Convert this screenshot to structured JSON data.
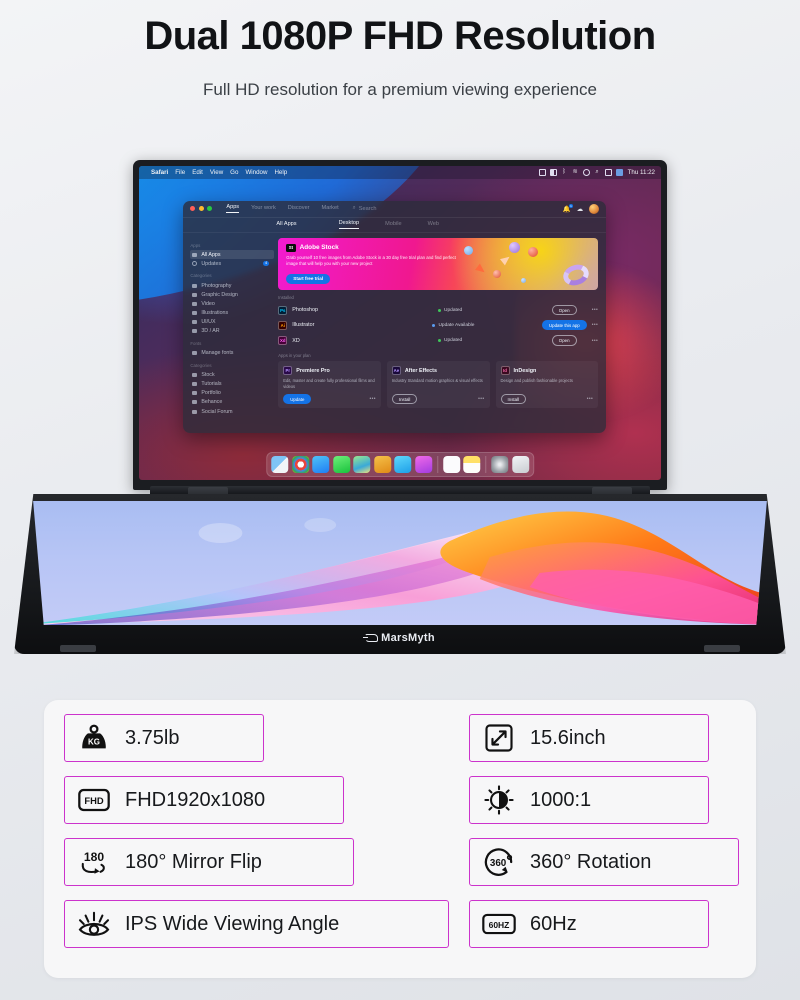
{
  "header": {
    "title": "Dual 1080P FHD Resolution",
    "subtitle": "Full HD resolution for a premium viewing experience"
  },
  "brand": {
    "name": "MarsMyth"
  },
  "accent_colors": {
    "spec_border": "#cc33cc",
    "panel_bg": "#f7f7f8",
    "adobe_blue": "#1473e6"
  },
  "laptop": {
    "top_screen": {
      "menubar": {
        "apple_glyph": "",
        "items": [
          "Safari",
          "File",
          "Edit",
          "View",
          "Go",
          "Window",
          "Help"
        ],
        "status_icons": [
          "screen-share-icon",
          "battery-icon",
          "bluetooth-icon",
          "wifi-icon",
          "control-center-icon",
          "search-icon",
          "display-icon",
          "user-icon"
        ],
        "clock": "Thu 11:22"
      },
      "window": {
        "tabs": [
          {
            "label": "Apps",
            "active": true
          },
          {
            "label": "Your work",
            "active": false
          },
          {
            "label": "Discover",
            "active": false
          },
          {
            "label": "Market",
            "active": false
          }
        ],
        "search_placeholder": "Search",
        "notification_count": "1",
        "subtabs": [
          {
            "label": "All Apps",
            "lead": true
          },
          {
            "label": "Desktop",
            "active": true
          },
          {
            "label": "Mobile",
            "active": false
          },
          {
            "label": "Web",
            "active": false
          }
        ],
        "sidebar": [
          {
            "group": "Apps",
            "items": [
              {
                "label": "All Apps",
                "selected": true,
                "badge": ""
              },
              {
                "label": "Updates",
                "selected": false,
                "badge": "4"
              }
            ]
          },
          {
            "group": "Categories",
            "items": [
              {
                "label": "Photography"
              },
              {
                "label": "Graphic Design"
              },
              {
                "label": "Video"
              },
              {
                "label": "Illustrations"
              },
              {
                "label": "UI/UX"
              },
              {
                "label": "3D / AR"
              }
            ]
          },
          {
            "group": "Fonts",
            "items": [
              {
                "label": "Manage fonts"
              }
            ]
          },
          {
            "group": "Categories",
            "items": [
              {
                "label": "Stock"
              },
              {
                "label": "Tutorials"
              },
              {
                "label": "Portfolio"
              },
              {
                "label": "Behance"
              },
              {
                "label": "Social Forum"
              }
            ]
          }
        ],
        "promo": {
          "chip": "St",
          "title": "Adobe Stock",
          "description": "Grab yourself 10 free images from Adobe Stock in a 30 day free trial plan and find perfect image that will help you with your new project",
          "button": "Start free trial"
        },
        "installed_label": "Installed",
        "installed": [
          {
            "icon": "Ps",
            "icon_color": "#00c8ff",
            "icon_bg": "#001e36",
            "name": "Photoshop",
            "status": "Updated",
            "status_color": "#3ec95a",
            "action": "Open",
            "action_style": "outline"
          },
          {
            "icon": "Ai",
            "icon_color": "#ff9a00",
            "icon_bg": "#330000",
            "name": "Illustrator",
            "status": "Update Available",
            "status_color": "#5a9cf0",
            "action": "Update this app",
            "action_style": "solid"
          },
          {
            "icon": "Xd",
            "icon_color": "#ff61f6",
            "icon_bg": "#470137",
            "name": "XD",
            "status": "Updated",
            "status_color": "#3ec95a",
            "action": "Open",
            "action_style": "outline"
          }
        ],
        "plan_label": "Apps in your plan",
        "plan_apps": [
          {
            "icon": "Pr",
            "icon_color": "#b695ff",
            "icon_bg": "#2a0a4a",
            "name": "Premiere Pro",
            "description": "Edit, master and create fully professional films and videos",
            "action": "Update",
            "action_style": "solid"
          },
          {
            "icon": "Ae",
            "icon_color": "#b695ff",
            "icon_bg": "#1a0a3a",
            "name": "After Effects",
            "description": "Industry Standard motion graphics & visual effects",
            "action": "Install",
            "action_style": "outline"
          },
          {
            "icon": "Id",
            "icon_color": "#ff6bb0",
            "icon_bg": "#3a0a20",
            "name": "InDesign",
            "description": "Design and publish fashionable projects",
            "action": "Install",
            "action_style": "outline"
          }
        ],
        "overflow_glyph": "•••"
      },
      "dock": [
        {
          "name": "finder-icon",
          "color": "#3fa0ee"
        },
        {
          "name": "chrome-icon",
          "color": "#e8453c"
        },
        {
          "name": "app-store-icon",
          "color": "#1f9bf5"
        },
        {
          "name": "messages-icon",
          "color": "#3ad152"
        },
        {
          "name": "maps-icon",
          "color": "#5ec97a"
        },
        {
          "name": "podcasts-icon",
          "color": "#f0a429"
        },
        {
          "name": "mail-icon",
          "color": "#1fb6f5"
        },
        {
          "name": "radio-icon",
          "color": "#d44ae0"
        },
        {
          "name": "reminders-icon",
          "color": "#ffffff"
        },
        {
          "name": "notes-icon",
          "color": "#ffe066"
        },
        {
          "name": "settings-icon",
          "color": "#8e9399"
        },
        {
          "name": "trash-icon",
          "color": "#d8dadd"
        }
      ]
    }
  },
  "specs": {
    "left": [
      {
        "icon": "weight-kettlebell-icon",
        "label": "3.75lb"
      },
      {
        "icon": "fhd-badge-icon",
        "label": "FHD1920x1080"
      },
      {
        "icon": "180-flip-icon",
        "label": "180° Mirror Flip"
      },
      {
        "icon": "eye-icon",
        "label": "IPS Wide Viewing Angle"
      }
    ],
    "right": [
      {
        "icon": "screen-size-arrows-icon",
        "label": "15.6inch"
      },
      {
        "icon": "contrast-sun-icon",
        "label": "1000:1"
      },
      {
        "icon": "360-rotation-icon",
        "label": "360° Rotation"
      },
      {
        "icon": "60hz-badge-icon",
        "label": "60Hz"
      }
    ]
  }
}
